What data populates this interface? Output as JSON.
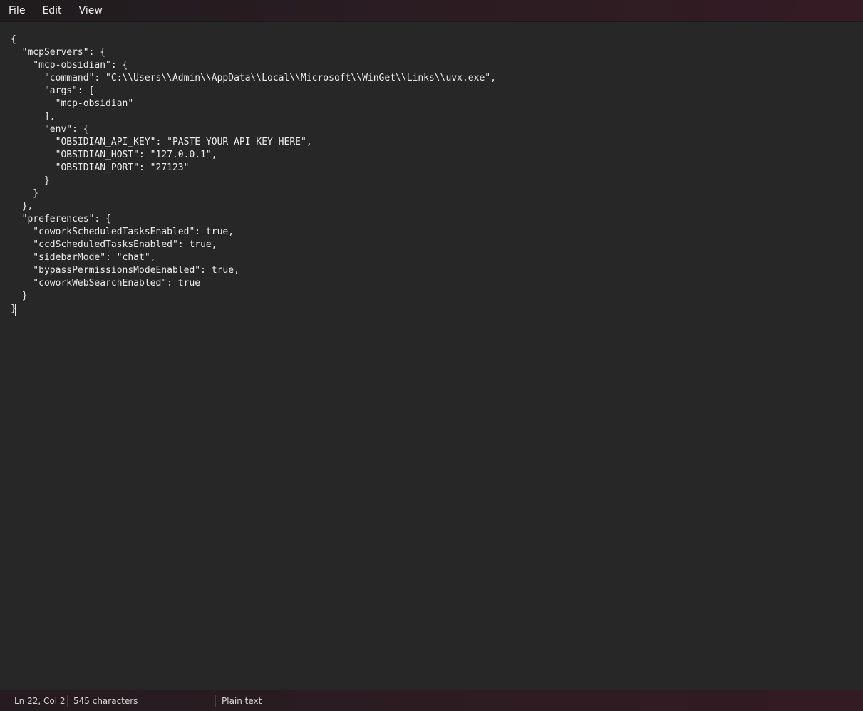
{
  "menu": {
    "file": "File",
    "edit": "Edit",
    "view": "View"
  },
  "editor": {
    "content": "{\n  \"mcpServers\": {\n    \"mcp-obsidian\": {\n      \"command\": \"C:\\\\Users\\\\Admin\\\\AppData\\\\Local\\\\Microsoft\\\\WinGet\\\\Links\\\\uvx.exe\",\n      \"args\": [\n        \"mcp-obsidian\"\n      ],\n      \"env\": {\n        \"OBSIDIAN_API_KEY\": \"PASTE YOUR API KEY HERE\",\n        \"OBSIDIAN_HOST\": \"127.0.0.1\",\n        \"OBSIDIAN_PORT\": \"27123\"\n      }\n    }\n  },\n  \"preferences\": {\n    \"coworkScheduledTasksEnabled\": true,\n    \"ccdScheduledTasksEnabled\": true,\n    \"sidebarMode\": \"chat\",\n    \"bypassPermissionsModeEnabled\": true,\n    \"coworkWebSearchEnabled\": true\n  }\n}"
  },
  "status": {
    "position": "Ln 22, Col 2",
    "characters": "545 characters",
    "mode": "Plain text"
  }
}
